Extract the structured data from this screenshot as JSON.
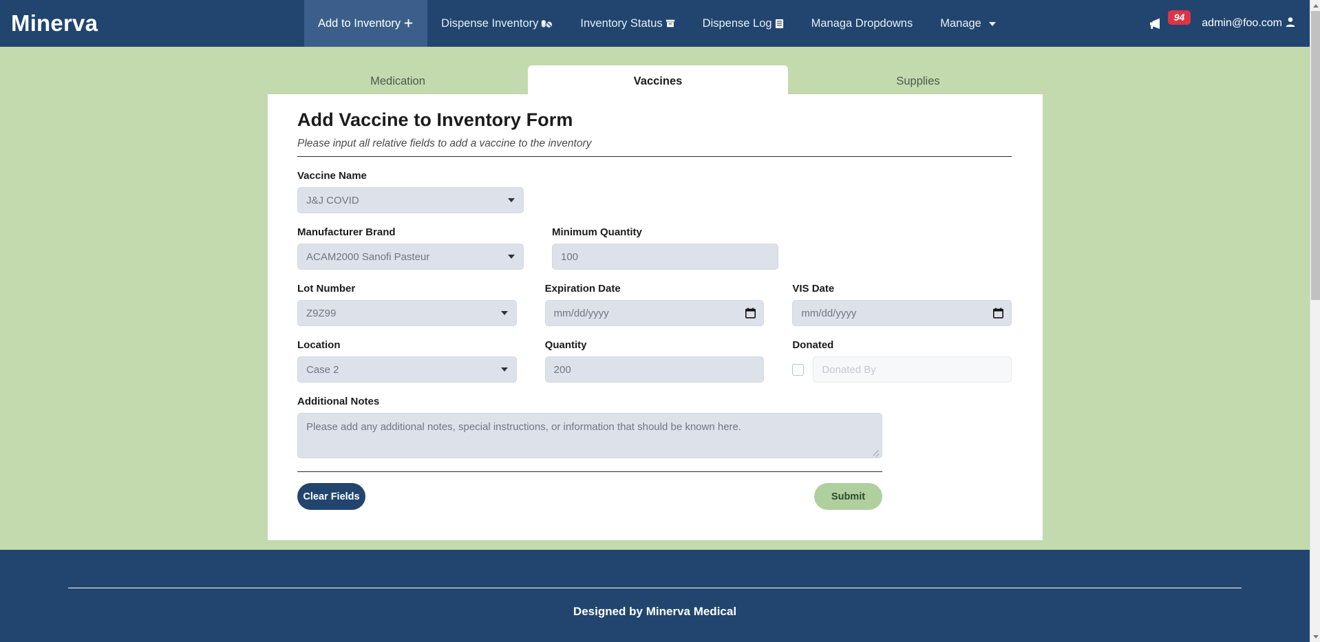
{
  "navbar": {
    "brand": "Minerva",
    "items": [
      {
        "label": "Add to Inventory",
        "icon": "plus-icon",
        "active": true
      },
      {
        "label": "Dispense Inventory",
        "icon": "pill-icon",
        "active": false
      },
      {
        "label": "Inventory Status",
        "icon": "box-icon",
        "active": false
      },
      {
        "label": "Dispense Log",
        "icon": "clipboard-list-icon",
        "active": false
      },
      {
        "label": "Managa Dropdowns",
        "icon": "",
        "active": false
      },
      {
        "label": "Manage",
        "icon": "chevron-down-icon",
        "active": false
      }
    ],
    "notifications": {
      "icon": "megaphone-icon",
      "count": "94",
      "badge_color": "#dc3545"
    },
    "user": {
      "email": "admin@foo.com",
      "icon": "user-icon"
    }
  },
  "tabs": [
    {
      "label": "Medication",
      "active": false
    },
    {
      "label": "Vaccines",
      "active": true
    },
    {
      "label": "Supplies",
      "active": false
    }
  ],
  "form": {
    "title": "Add Vaccine to Inventory Form",
    "subtitle": "Please input all relative fields to add a vaccine to the inventory",
    "fields": {
      "vaccine_name": {
        "label": "Vaccine Name",
        "value": "J&J COVID",
        "type": "select"
      },
      "manufacturer_brand": {
        "label": "Manufacturer Brand",
        "value": "ACAM2000 Sanofi Pasteur",
        "type": "select"
      },
      "minimum_quantity": {
        "label": "Minimum Quantity",
        "value": "100",
        "type": "text"
      },
      "lot_number": {
        "label": "Lot Number",
        "value": "Z9Z99",
        "type": "select"
      },
      "expiration_date": {
        "label": "Expiration Date",
        "value": "mm/dd/yyyy",
        "type": "date"
      },
      "vis_date": {
        "label": "VIS Date",
        "value": "mm/dd/yyyy",
        "type": "date"
      },
      "location": {
        "label": "Location",
        "value": "Case 2",
        "type": "select"
      },
      "quantity": {
        "label": "Quantity",
        "value": "200",
        "type": "text"
      },
      "donated": {
        "label": "Donated",
        "checked": false
      },
      "donated_by": {
        "placeholder": "Donated By",
        "value": "",
        "disabled": true
      },
      "additional_notes": {
        "label": "Additional Notes",
        "placeholder": "Please add any additional notes, special instructions, or information that should be known here.",
        "value": ""
      }
    },
    "buttons": {
      "clear": "Clear Fields",
      "submit": "Submit"
    }
  },
  "footer": {
    "text": "Designed by Minerva Medical"
  },
  "colors": {
    "navy": "#21456f",
    "nav_active": "#3b5f8a",
    "green_body": "#c3d9ae",
    "submit_green": "#afcf9f",
    "field_gray": "#dde1e9",
    "badge_red": "#dc3545"
  }
}
